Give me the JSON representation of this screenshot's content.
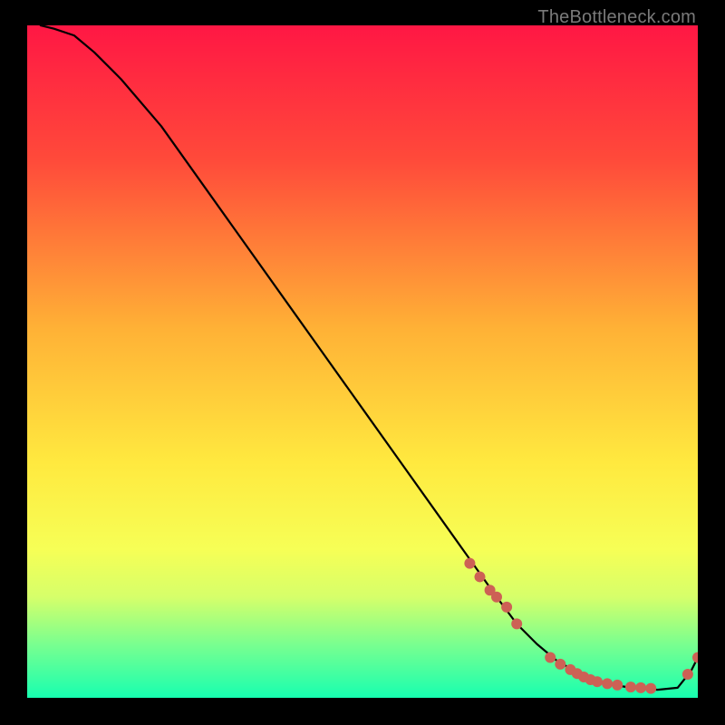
{
  "watermark": "TheBottleneck.com",
  "chart_data": {
    "type": "line",
    "title": "",
    "xlabel": "",
    "ylabel": "",
    "xlim": [
      0,
      100
    ],
    "ylim": [
      0,
      100
    ],
    "grid": false,
    "legend": false,
    "gradient_stops": [
      {
        "offset": 0,
        "color": "#ff1744"
      },
      {
        "offset": 20,
        "color": "#ff4a3a"
      },
      {
        "offset": 45,
        "color": "#ffb136"
      },
      {
        "offset": 65,
        "color": "#ffe93f"
      },
      {
        "offset": 78,
        "color": "#f6ff56"
      },
      {
        "offset": 85,
        "color": "#d6ff6a"
      },
      {
        "offset": 92,
        "color": "#7aff8f"
      },
      {
        "offset": 100,
        "color": "#17ffb0"
      }
    ],
    "series": [
      {
        "name": "curve",
        "type": "line",
        "color": "#000000",
        "x": [
          2,
          4,
          7,
          10,
          14,
          20,
          30,
          40,
          50,
          60,
          65,
          70,
          73,
          76,
          79,
          82,
          85,
          88,
          91,
          94,
          97,
          99,
          100
        ],
        "y": [
          100,
          99.5,
          98.5,
          96,
          92,
          85,
          71,
          57,
          43,
          29,
          22,
          15,
          11,
          8,
          5.5,
          3.8,
          2.5,
          1.8,
          1.4,
          1.2,
          1.5,
          4,
          6
        ]
      },
      {
        "name": "points",
        "type": "scatter",
        "color": "#cd6155",
        "x": [
          66,
          67.5,
          69,
          70,
          71.5,
          73,
          78,
          79.5,
          81,
          82,
          83,
          84,
          85,
          86.5,
          88,
          90,
          91.5,
          93,
          98.5,
          100
        ],
        "y": [
          20,
          18,
          16,
          15,
          13.5,
          11,
          6,
          5,
          4.2,
          3.6,
          3.1,
          2.7,
          2.4,
          2.1,
          1.9,
          1.6,
          1.5,
          1.4,
          3.5,
          6
        ]
      }
    ]
  }
}
